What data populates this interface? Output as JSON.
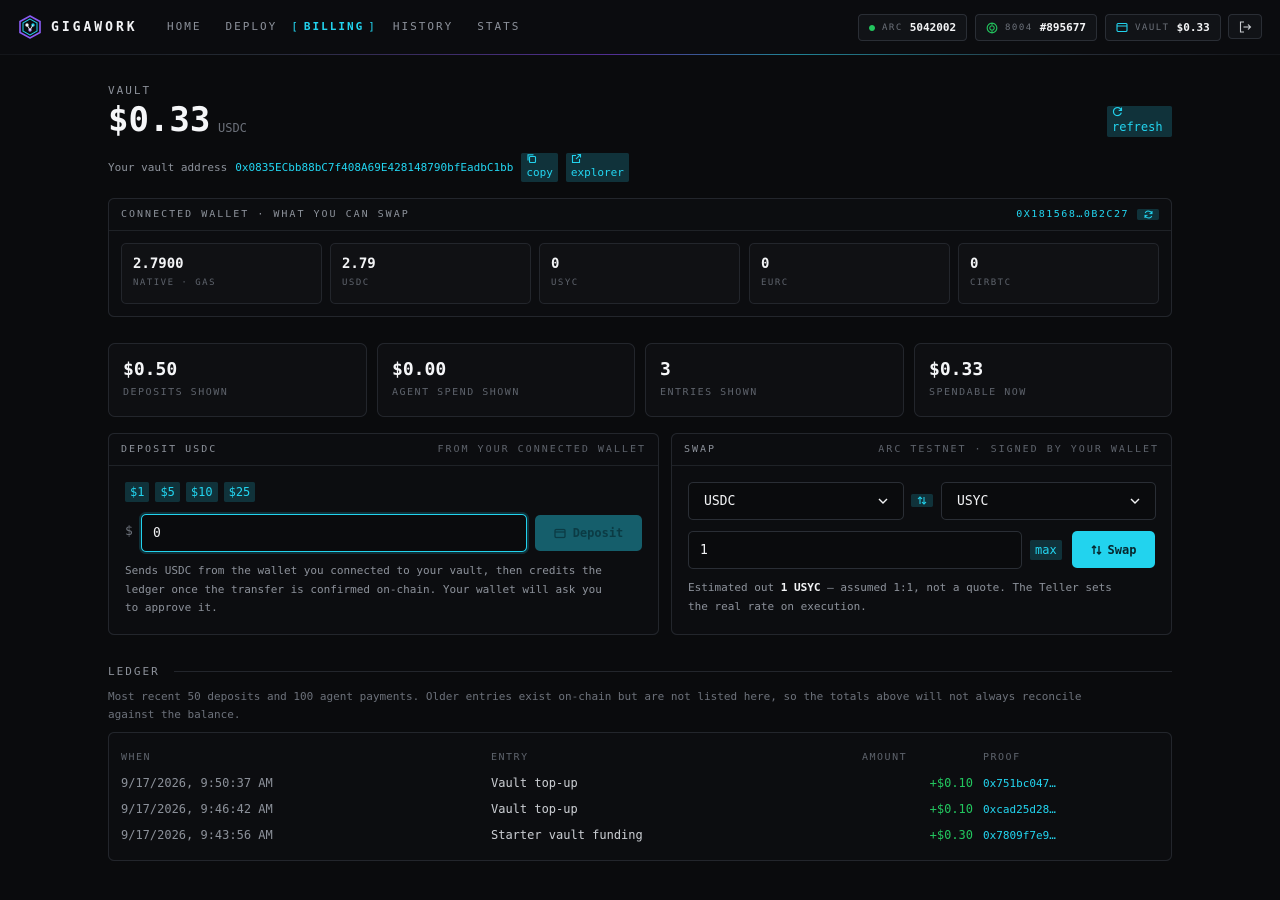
{
  "brand": {
    "name": "GIGAWORK"
  },
  "nav": {
    "home": "HOME",
    "deploy": "DEPLOY",
    "billing": "BILLING",
    "history": "HISTORY",
    "stats": "STATS",
    "active_open": "[",
    "active_close": "]"
  },
  "status": {
    "arc_label": "ARC",
    "arc_value": "5042002",
    "id_label": "8004",
    "id_value": "#895677",
    "vault_label": "VAULT",
    "vault_value": "$0.33"
  },
  "vault": {
    "label": "VAULT",
    "amount": "$0.33",
    "unit": "USDC",
    "refresh": "refresh",
    "address_label": "Your vault address",
    "address": "0x0835ECbb88bC7f408A69E428148790bfEadbC1bb",
    "copy": "copy",
    "explorer": "explorer"
  },
  "wallet": {
    "title": "CONNECTED WALLET · WHAT YOU CAN SWAP",
    "address": "0X181568…0B2C27",
    "balances": [
      {
        "value": "2.7900",
        "label": "NATIVE · GAS"
      },
      {
        "value": "2.79",
        "label": "USDC"
      },
      {
        "value": "0",
        "label": "USYC"
      },
      {
        "value": "0",
        "label": "EURC"
      },
      {
        "value": "0",
        "label": "CIRBTC"
      }
    ]
  },
  "stats": [
    {
      "value": "$0.50",
      "label": "DEPOSITS SHOWN"
    },
    {
      "value": "$0.00",
      "label": "AGENT SPEND SHOWN"
    },
    {
      "value": "3",
      "label": "ENTRIES SHOWN"
    },
    {
      "value": "$0.33",
      "label": "SPENDABLE NOW"
    }
  ],
  "deposit": {
    "title": "DEPOSIT USDC",
    "subtitle": "FROM YOUR CONNECTED WALLET",
    "chips": [
      "$1",
      "$5",
      "$10",
      "$25"
    ],
    "currency_symbol": "$",
    "amount": "0",
    "button": "Deposit",
    "note_lines": [
      "Sends USDC from the wallet you connected to your vault, then credits the",
      "ledger once the transfer is confirmed on-chain. Your wallet will ask you",
      "to approve it."
    ]
  },
  "swap": {
    "title": "SWAP",
    "subtitle": "ARC TESTNET · SIGNED BY YOUR WALLET",
    "from": "USDC",
    "to": "USYC",
    "amount": "1",
    "max": "max",
    "button": "Swap",
    "note_prefix": "Estimated out ",
    "note_value": "1 USYC",
    "note_suffix": " — assumed 1:1, not a quote. The Teller sets",
    "note_line2": "the real rate on execution."
  },
  "ledger": {
    "title": "LEDGER",
    "note_line1": "Most recent 50 deposits and 100 agent payments. Older entries exist on-chain but are not listed here, so the totals above will not always reconcile",
    "note_line2": "against the balance.",
    "columns": {
      "when": "WHEN",
      "entry": "ENTRY",
      "amount": "AMOUNT",
      "proof": "PROOF"
    },
    "rows": [
      {
        "when": "9/17/2026, 9:50:37 AM",
        "entry": "Vault top-up",
        "amount": "+$0.10",
        "proof": "0x751bc047…"
      },
      {
        "when": "9/17/2026, 9:46:42 AM",
        "entry": "Vault top-up",
        "amount": "+$0.10",
        "proof": "0xcad25d28…"
      },
      {
        "when": "9/17/2026, 9:43:56 AM",
        "entry": "Starter vault funding",
        "amount": "+$0.30",
        "proof": "0x7809f7e9…"
      }
    ]
  },
  "colors": {
    "accent": "#22d3ee",
    "positive": "#22c55e",
    "background": "#0a0b0d"
  },
  "icons": [
    "brand-logo-icon",
    "gas-icon",
    "vault-icon",
    "logout-icon",
    "refresh-icon",
    "copy-icon",
    "external-link-icon",
    "swap-arrows-icon",
    "wallet-icon",
    "chevron-down-icon"
  ]
}
